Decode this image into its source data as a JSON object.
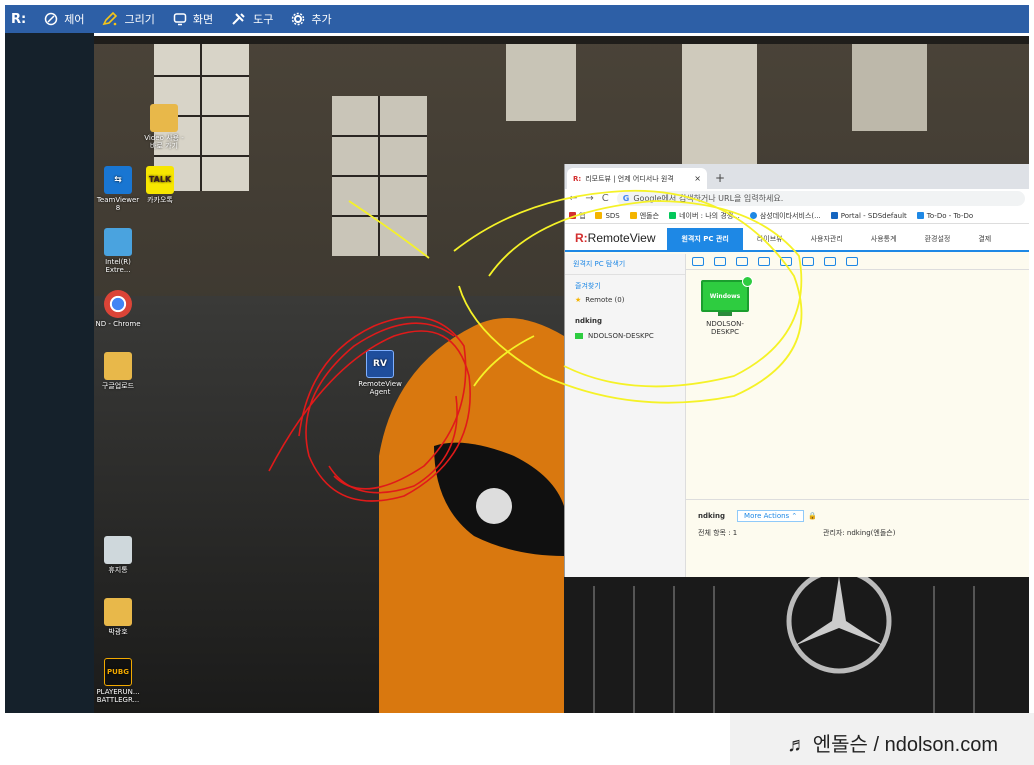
{
  "toolbar": {
    "logo": "R:",
    "items": [
      {
        "label": "제어",
        "icon": "control-icon"
      },
      {
        "label": "그리기",
        "icon": "pencil-icon"
      },
      {
        "label": "화면",
        "icon": "screen-icon"
      },
      {
        "label": "도구",
        "icon": "tools-icon"
      },
      {
        "label": "추가",
        "icon": "gear-icon"
      }
    ]
  },
  "desktop": {
    "icons": [
      {
        "label": "Video 사용 - 바로 가기",
        "icon": "folder-icon"
      },
      {
        "label": "TeamViewer 8",
        "icon": "teamviewer-icon"
      },
      {
        "label": "카카오톡",
        "icon": "kakaotalk-icon"
      },
      {
        "label": "Intel(R) Extre...",
        "icon": "intel-icon"
      },
      {
        "label": "ND - Chrome",
        "icon": "chrome-icon"
      },
      {
        "label": "구글업로드",
        "icon": "folder-icon"
      },
      {
        "label": "RemoteView Agent",
        "icon": "remoteview-agent-icon",
        "badge": "RV"
      },
      {
        "label": "휴지통",
        "icon": "recycle-bin-icon"
      },
      {
        "label": "박광호",
        "icon": "user-folder-icon"
      },
      {
        "label": "PLAYERUN... BATTLEGR...",
        "icon": "pubg-icon",
        "badge": "PUBG"
      }
    ]
  },
  "browser": {
    "tab_title": "리모트뷰 | 언제 어디서나 원격",
    "tab_close": "×",
    "new_tab": "+",
    "address_placeholder": "Google에서 검색하거나 URL을 입력하세요.",
    "bookmarks": [
      "앱",
      "SDS",
      "엔돌슨",
      "네이버 : 나의 경쟁...",
      "삼성데이타서비스(...",
      "Portal - SDSdefault",
      "To-Do - To-Do"
    ]
  },
  "remoteview": {
    "brand": "RemoteView",
    "nav": [
      "원격지 PC 관리",
      "라이브뷰",
      "사용자관리",
      "사용통계",
      "환경설정",
      "결제"
    ],
    "search_link": "원격지 PC 탐색기",
    "favorites_label": "즐겨찾기",
    "favorite_item": "Remote (0)",
    "group_name": "ndking",
    "group_pc": "NDOLSON-DESKPC",
    "pc_screen_label": "Windows",
    "pc_name": "NDOLSON-DESKPC",
    "bottom_group": "ndking",
    "more_actions": "More Actions",
    "total_label": "전체 항목 : 1",
    "admin_label": "관리자: ndking(엔돌슨)"
  },
  "watermark": "♬ 엔돌슨 / ndolson.com",
  "colors": {
    "toolbar_bg": "#2d5fa6",
    "annotation_red": "#e01a1a",
    "annotation_yellow": "#f5f227",
    "accent_blue": "#1e88e5"
  }
}
